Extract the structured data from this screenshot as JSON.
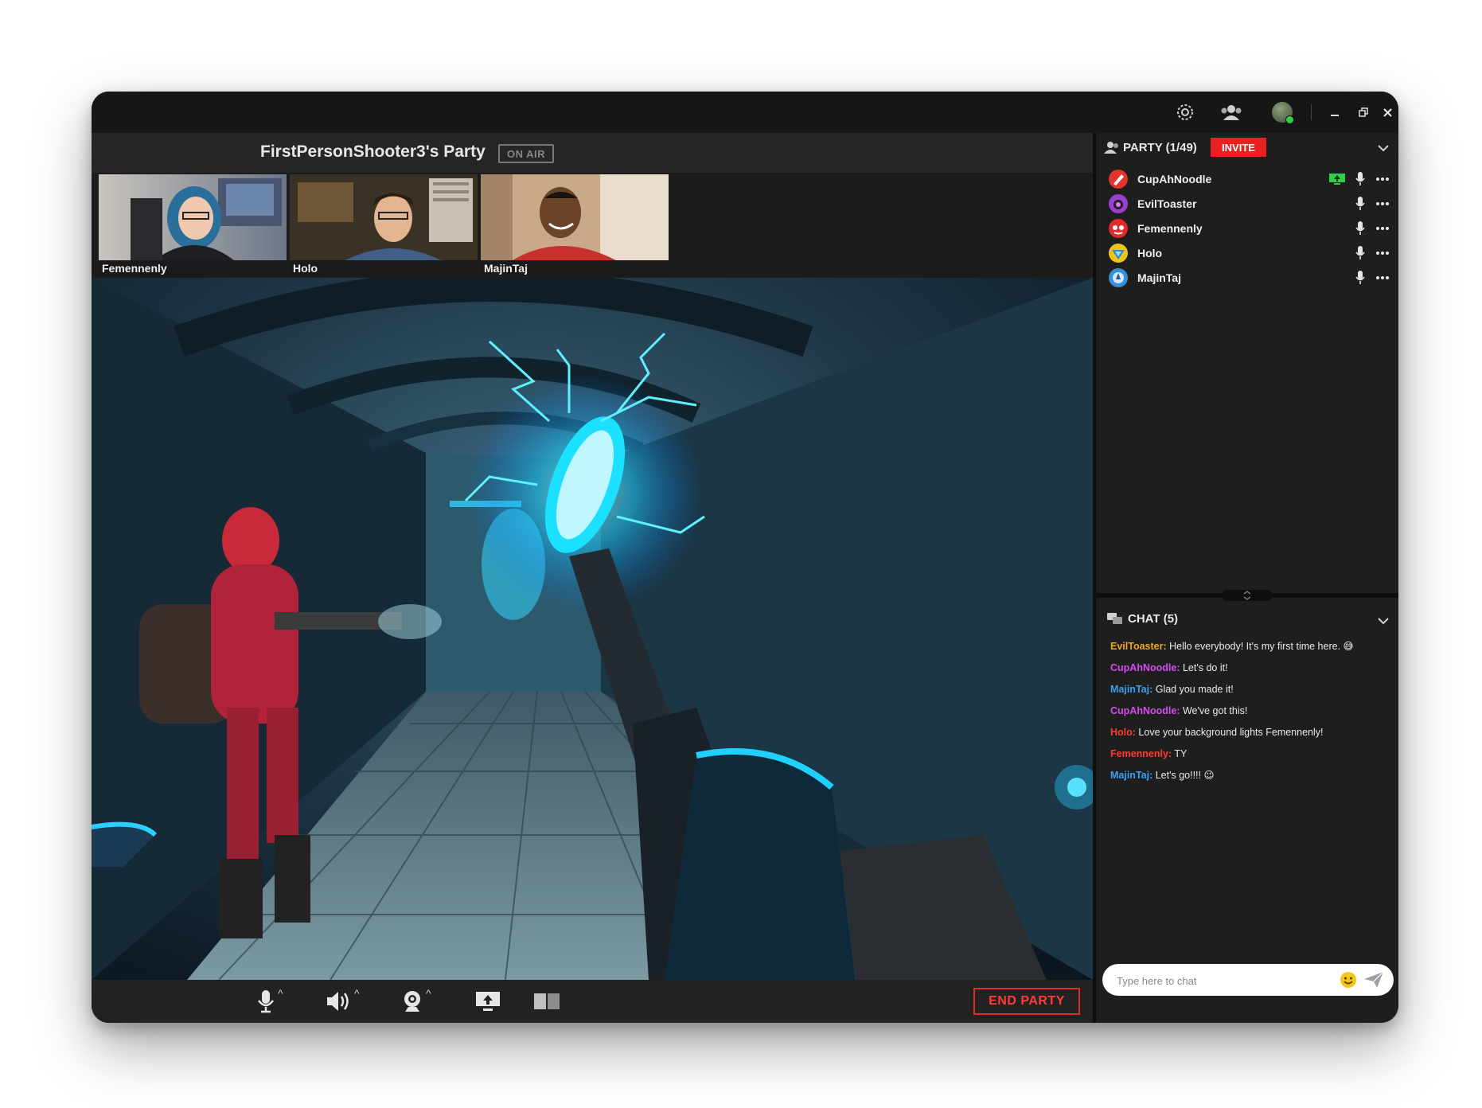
{
  "party": {
    "title": "FirstPersonShooter3's Party",
    "on_air": "ON AIR"
  },
  "webcams": [
    {
      "name": "Femennenly"
    },
    {
      "name": "Holo"
    },
    {
      "name": "MajinTaj"
    }
  ],
  "controls": {
    "caret": "^",
    "end_party": "END PARTY"
  },
  "sidebar": {
    "party_label": "PARTY (1/49)",
    "invite": "INVITE",
    "members": [
      {
        "name": "CupAhNoodle",
        "streaming": true,
        "color": "#e2332f"
      },
      {
        "name": "EvilToaster",
        "streaming": false,
        "color": "#9b3fd0"
      },
      {
        "name": "Femennenly",
        "streaming": false,
        "color": "#e22a2a"
      },
      {
        "name": "Holo",
        "streaming": false,
        "color": "#f0c419"
      },
      {
        "name": "MajinTaj",
        "streaming": false,
        "color": "#3a8ed6"
      }
    ],
    "chat_label": "CHAT (5)",
    "messages": [
      {
        "user": "EvilToaster:",
        "text": " Hello everybody!  It's my first time here. 😅",
        "color": "#f0a820"
      },
      {
        "user": "CupAhNoodle:",
        "text": " Let's do it!",
        "color": "#d64bf0"
      },
      {
        "user": "MajinTaj:",
        "text": " Glad you made it!",
        "color": "#3aa0f0"
      },
      {
        "user": "CupAhNoodle:",
        "text": " We've got this!",
        "color": "#d64bf0"
      },
      {
        "user": "Holo:",
        "text": " Love your background lights Femennenly!",
        "color": "#ff3b2f"
      },
      {
        "user": "Femennenly:",
        "text": " TY",
        "color": "#ff3b2f"
      },
      {
        "user": "MajinTaj:",
        "text": " Let's go!!!!   😉",
        "color": "#3aa0f0"
      }
    ],
    "chat_placeholder": "Type here to chat"
  },
  "colors": {
    "accent_red": "#e8201f",
    "stream_green": "#2fd04a"
  }
}
